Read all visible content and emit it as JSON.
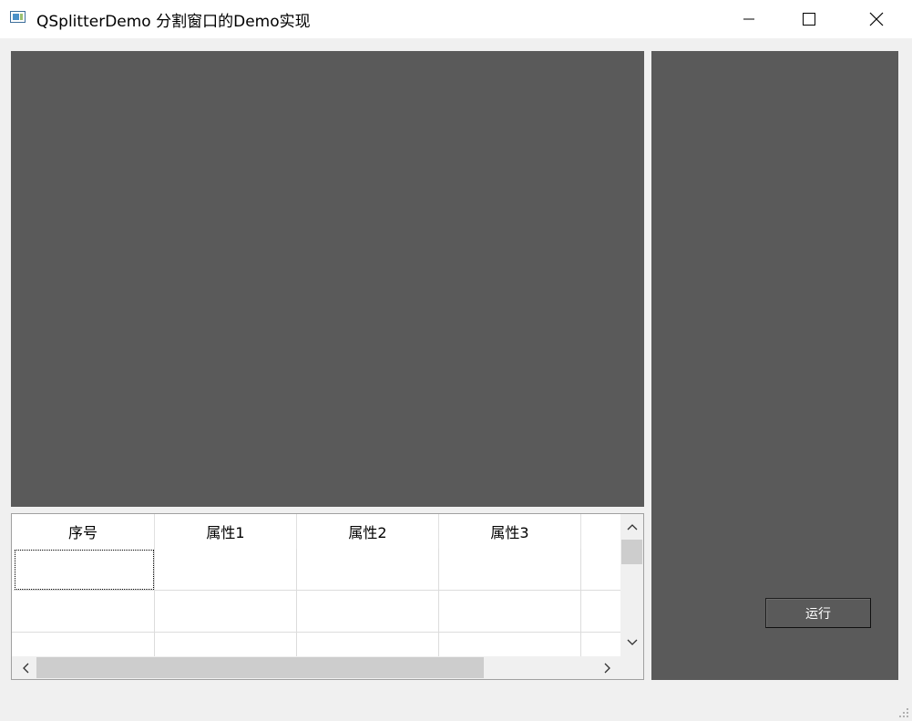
{
  "window": {
    "title": "QSplitterDemo 分割窗口的Demo实现",
    "icon": "app-window-icon",
    "controls": [
      "minimize-icon",
      "maximize-icon",
      "close-icon"
    ]
  },
  "panes": {
    "top_color": "#5a5a5a",
    "right_color": "#5a5a5a"
  },
  "right_panel": {
    "run_label": "运行"
  },
  "table": {
    "columns": [
      "序号",
      "属性1",
      "属性2",
      "属性3"
    ],
    "rows": [
      [
        "",
        "",
        "",
        ""
      ],
      [
        "",
        "",
        "",
        ""
      ],
      [
        "",
        "",
        "",
        ""
      ]
    ]
  }
}
